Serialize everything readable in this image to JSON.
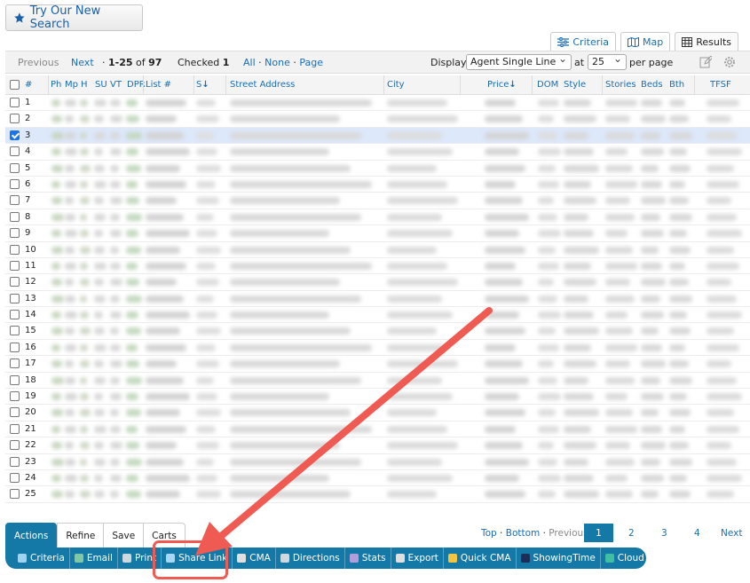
{
  "search_button": {
    "label": "Try Our New Search"
  },
  "view_tabs": [
    {
      "label": "Criteria"
    },
    {
      "label": "Map"
    },
    {
      "label": "Results"
    }
  ],
  "toolbar": {
    "previous": "Previous",
    "next": "Next",
    "range": "1-25",
    "of_label": "of",
    "total": "97",
    "checked_label": "Checked",
    "checked_count": "1",
    "select_all": "All",
    "select_none": "None",
    "select_page": "Page",
    "display_label": "Display",
    "display_value": "Agent Single Line",
    "at_label": "at",
    "per_page_value": "25",
    "per_page_label": "per page"
  },
  "columns": {
    "num": "#",
    "ph": "Ph",
    "mp": "Mp",
    "h": "H",
    "su": "SU",
    "vt": "VT",
    "dpr": "DPR",
    "list": "List #",
    "s": "S",
    "street": "Street Address",
    "city": "City",
    "price": "Price",
    "dom": "DOM",
    "style": "Style",
    "stories": "Stories",
    "beds": "Beds",
    "bth": "Bth",
    "tfsf": "TFSF"
  },
  "rows": [
    "1",
    "2",
    "3",
    "4",
    "5",
    "6",
    "7",
    "8",
    "9",
    "10",
    "11",
    "12",
    "13",
    "14",
    "15",
    "16",
    "17",
    "18",
    "19",
    "20",
    "21",
    "22",
    "23",
    "24",
    "25"
  ],
  "checked_row": "3",
  "bottom_tabs": [
    {
      "label": "Actions"
    },
    {
      "label": "Refine"
    },
    {
      "label": "Save"
    },
    {
      "label": "Carts"
    }
  ],
  "pagination": {
    "top": "Top",
    "bottom": "Bottom",
    "previous": "Previous",
    "pages": [
      "1",
      "2",
      "3",
      "4"
    ],
    "next": "Next"
  },
  "actions": [
    {
      "label": "Criteria",
      "color": "#9fd3f0"
    },
    {
      "label": "Email",
      "color": "#7fc7a5"
    },
    {
      "label": "Print",
      "color": "#cfd8dc"
    },
    {
      "label": "Share Link",
      "color": "#a7d7f5"
    },
    {
      "label": "CMA",
      "color": "#e0e0e0"
    },
    {
      "label": "Directions",
      "color": "#cfd8dc"
    },
    {
      "label": "Stats",
      "color": "#b39ddb"
    },
    {
      "label": "Export",
      "color": "#e0e0e0"
    },
    {
      "label": "Quick CMA",
      "color": "#f4c542"
    },
    {
      "label": "ShowingTime",
      "color": "#1c2d5a"
    },
    {
      "label": "Cloud CMA",
      "color": "#3fbfa3"
    }
  ]
}
